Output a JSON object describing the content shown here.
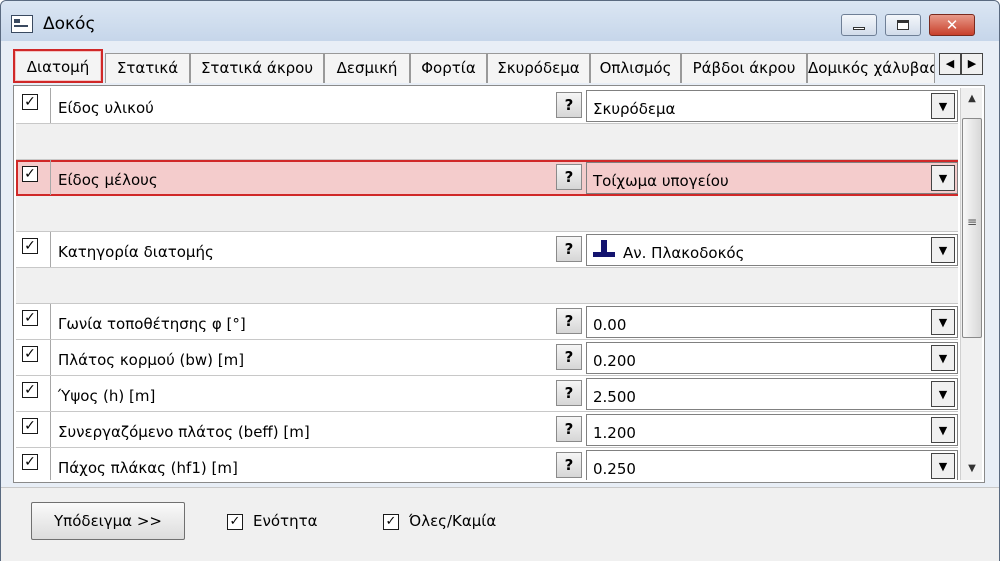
{
  "window": {
    "title": "Δοκός"
  },
  "tabs": [
    {
      "label": "Διατομή",
      "active": true
    },
    {
      "label": "Στατικά"
    },
    {
      "label": "Στατικά άκρου"
    },
    {
      "label": "Δεσμική"
    },
    {
      "label": "Φορτία"
    },
    {
      "label": "Σκυρόδεμα"
    },
    {
      "label": "Οπλισμός"
    },
    {
      "label": "Ράβδοι άκρου"
    },
    {
      "label": "Δομικός χάλυβας"
    }
  ],
  "properties": [
    {
      "label": "Είδος υλικού",
      "value": "Σκυρόδεμα",
      "checked": true
    },
    {
      "label": "Είδος μέλους",
      "value": "Τοίχωμα υπογείου",
      "checked": true,
      "highlighted": true
    },
    {
      "label": "Κατηγορία διατομής",
      "value": "Αν. Πλακοδοκός",
      "checked": true,
      "icon": "t-beam-icon"
    },
    {
      "label": "Γωνία τοποθέτησης φ [°]",
      "value": "0.00",
      "checked": true
    },
    {
      "label": "Πλάτος κορμού (bw) [m]",
      "value": "0.200",
      "checked": true
    },
    {
      "label": "Ύψος (h) [m]",
      "value": "2.500",
      "checked": true
    },
    {
      "label": "Συνεργαζόμενο πλάτος (beff) [m]",
      "value": "1.200",
      "checked": true
    },
    {
      "label": "Πάχος πλάκας (hf1) [m]",
      "value": "0.250",
      "checked": true
    }
  ],
  "help_label": "?",
  "footer": {
    "sample_button": "Υπόδειγμα >>",
    "unit_checkbox": {
      "label": "Ενότητα",
      "checked": true
    },
    "all_none_checkbox": {
      "label": "Όλες/Καμία",
      "checked": true
    }
  },
  "colors": {
    "highlight": "#f4cccc",
    "highlight_border": "#d02828",
    "icon": "#13136e"
  }
}
